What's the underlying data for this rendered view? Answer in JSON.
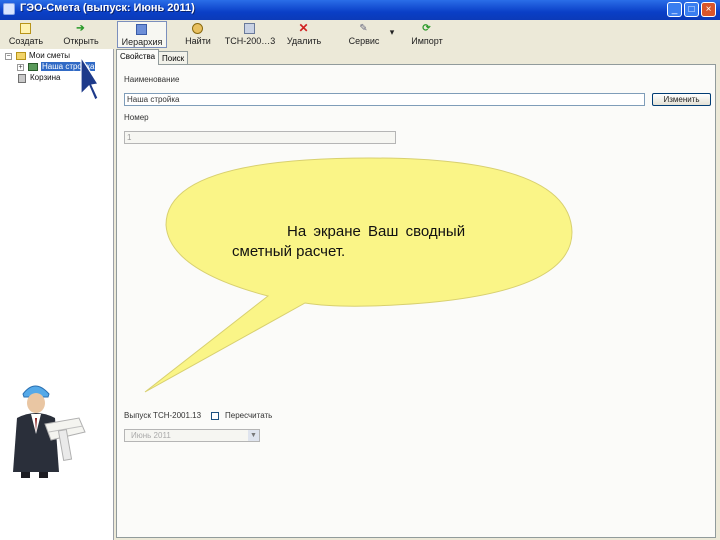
{
  "window": {
    "title": "ГЭО-Смета (выпуск: Июнь 2011)",
    "controls": [
      "_",
      "□",
      "×"
    ]
  },
  "toolbar": {
    "items": [
      {
        "label": "Создать",
        "icon": "new-icon"
      },
      {
        "label": "Открыть",
        "icon": "open-arrow-icon"
      },
      {
        "label": "Иерархия",
        "icon": "hierarchy-icon"
      },
      {
        "label": "Найти",
        "icon": "find-icon"
      },
      {
        "label": "ТСН-200…3",
        "icon": "tsn-icon"
      },
      {
        "label": "Удалить",
        "icon": "delete-icon"
      },
      {
        "label": "Сервис",
        "icon": "service-icon"
      },
      {
        "label": "Импорт",
        "icon": "import-icon"
      }
    ],
    "dropdown_glyph": "▾"
  },
  "tree": {
    "items": [
      {
        "label": "Мои сметы",
        "toggle": "−"
      },
      {
        "label": "Наша стройка",
        "toggle": "+"
      },
      {
        "label": "Корзина",
        "toggle": ""
      }
    ]
  },
  "tabs": [
    "Свойства",
    "Поиск"
  ],
  "properties": {
    "name_label": "Наименование",
    "name_value": "Наша стройка",
    "change_button": "Изменить",
    "number_label": "Номер",
    "number_value": "1",
    "release_label": "Выпуск ТСН-2001.13",
    "recalc_label": "Пересчитать",
    "release_value": "Июнь 2011"
  },
  "callout": {
    "line1": "На экране Ваш сводный",
    "line2": "сметный расчет.",
    "color": "#FAF587"
  }
}
